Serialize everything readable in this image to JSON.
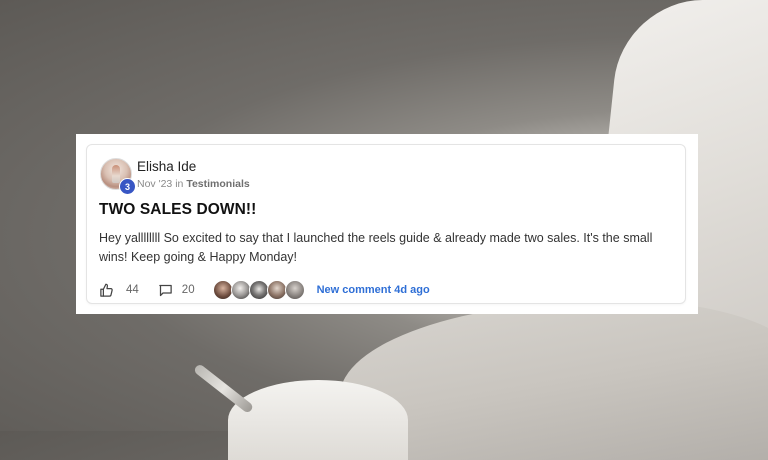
{
  "post": {
    "author": "Elisha Ide",
    "level": "3",
    "date": "Nov '23",
    "in_label": "in",
    "category": "Testimonials",
    "title": "TWO SALES DOWN!!",
    "body": "Hey yallllllll So excited to say that I launched the reels guide & already made two sales. It's the small wins! Keep going & Happy Monday!",
    "likes": "44",
    "comments": "20",
    "last_activity": "New comment 4d ago",
    "participants_count": 5
  },
  "colors": {
    "accent": "#2f6fd6",
    "level_badge": "#3856c4"
  },
  "icons": {
    "like": "thumbs-up-icon",
    "comment": "comment-bubble-icon"
  }
}
